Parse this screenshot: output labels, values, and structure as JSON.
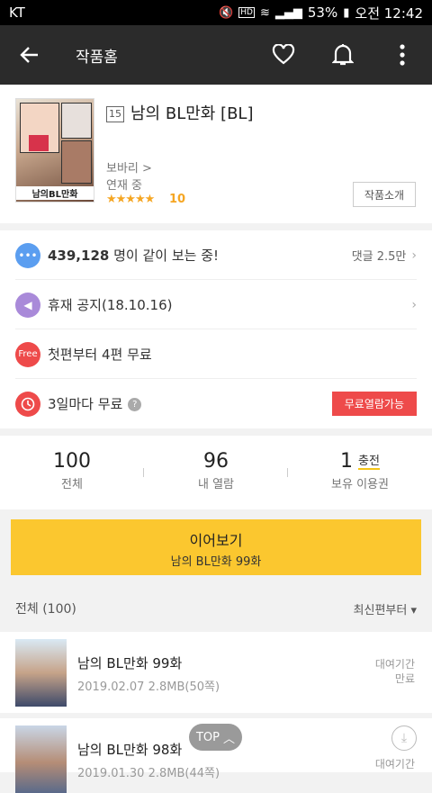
{
  "status_bar": {
    "carrier": "KT",
    "hd": "HD",
    "battery": "53%",
    "time": "오전 12:42"
  },
  "app_bar": {
    "title": "작품홈"
  },
  "work": {
    "age": "15",
    "title": "남의 BL만화 [BL]",
    "thumb_logo": "남의BL만화",
    "author": "보바리 >",
    "status": "연재 중",
    "stars": "★★★★★",
    "rating": "10",
    "intro_button": "작품소개"
  },
  "info": {
    "viewers_count": "439,128",
    "viewers_text": " 명이 같이 보는 중!",
    "comments": "댓글 2.5만",
    "notice": "휴재 공지(18.10.16)",
    "free_badge_icon": "Free",
    "free_first": "첫편부터 4편 무료",
    "wait_free": "3일마다 무료",
    "help": "?",
    "wait_free_badge": "무료열람가능"
  },
  "counts": [
    {
      "num": "100",
      "label": "전체"
    },
    {
      "num": "96",
      "label": "내 열람"
    },
    {
      "num": "1",
      "label": "보유 이용권",
      "extra": "충전"
    }
  ],
  "continue": {
    "label": "이어보기",
    "episode": "남의 BL만화 99화"
  },
  "list": {
    "header": "전체 (100)",
    "sort": "최신편부터 ▾"
  },
  "episodes": [
    {
      "title": "남의 BL만화 99화",
      "meta": "2019.02.07  2.8MB(50쪽)",
      "status_line1": "대여기간",
      "status_line2": "만료"
    },
    {
      "title": "남의 BL만화 98화",
      "meta": "2019.01.30  2.8MB(44쪽)",
      "status_line1": "대여기간"
    }
  ],
  "top_button": "TOP",
  "colors": {
    "accent_yellow": "#fbc72f",
    "star": "#f5a623",
    "red": "#ee4a4a"
  }
}
